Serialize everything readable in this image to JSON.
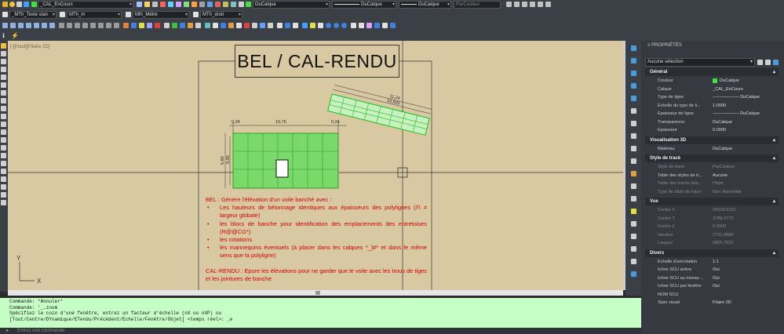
{
  "toolbar": {
    "layer_current": "_CAL_EnCours",
    "color": "DuCalque",
    "linetype": "DuCalque",
    "lineweight": "DuCalque",
    "plotstyle": "ParCouleur",
    "text_style": "_MTh_Texte stan",
    "dim_style": "MTh_m",
    "table_style": "Mth_Métré",
    "multileader_style": "MTh_droit"
  },
  "canvas": {
    "viewport_label": "[-][Haut][Filaire 2D]",
    "title": "BEL / CAL-RENDU",
    "dims": {
      "left_gap": "0,24",
      "top_length": "10,76",
      "right_gap": "0,24",
      "height_outer": "5,60",
      "height_inner": "5,00",
      "rot_length": "11,24",
      "rot_length2": "10,500"
    },
    "description": {
      "intro": "BEL : Génère l'élévation d'un voile banché avec :",
      "bullets": [
        "Les hauteurs de bétonnage identiques aux épaisseurs des polylignes (/!\\ ≠ largeur globale)",
        "les blocs de banche pour identification des emplacements des entretoises (R@@CG*)",
        "les cotations",
        "les mannequins éventuels (à placer dans les calques *_)#* et dans le même sens que la polyligne)"
      ],
      "outro": "CAL-RENDU : Epure les élévations pour ne garder que le voile avec les trous de tiges et les jointures de banche"
    },
    "ucs": {
      "x": "X",
      "y": "Y"
    }
  },
  "command": {
    "lines": [
      "Commande: *Annuler*",
      "Commande: '_.zoom",
      "Spécifiez le coin d'une fenêtre, entrez un facteur d'échelle (nX ou nXP) ou",
      "[Tout/Centre/DYnamique/ETendu/Précédent/Echelle/Fenêtre/Objet] <temps réel>: _e"
    ],
    "placeholder": "Entrez une commande"
  },
  "properties": {
    "title": "PROPRIÉTÉS",
    "selection": "Aucune sélection",
    "sections": [
      {
        "name": "Général",
        "rows": [
          {
            "k": "Couleur",
            "v": "DuCalque",
            "swatch": "#44dd44"
          },
          {
            "k": "Calque",
            "v": "_CAL_EnCours"
          },
          {
            "k": "Type de ligne",
            "v": "—————— DuCalque"
          },
          {
            "k": "Echelle du type de li...",
            "v": "1.0000"
          },
          {
            "k": "Epaisseur de ligne",
            "v": "—————— DuCalque"
          },
          {
            "k": "Transparence",
            "v": "DuCalque"
          },
          {
            "k": "Epaisseur",
            "v": "0.0000"
          }
        ]
      },
      {
        "name": "Visualisation 3D",
        "rows": [
          {
            "k": "Matériau",
            "v": "DuCalque"
          }
        ]
      },
      {
        "name": "Style de tracé",
        "rows": [
          {
            "k": "Style de tracé",
            "v": "ParCouleur",
            "dim": true
          },
          {
            "k": "Table des styles de tr...",
            "v": "Aucune"
          },
          {
            "k": "Table des tracés atta...",
            "v": "Objet",
            "dim": true
          },
          {
            "k": "Type de table de tracé",
            "v": "Non disponible",
            "dim": true
          }
        ]
      },
      {
        "name": "Vue",
        "rows": [
          {
            "k": "Centre X",
            "v": "26629.5391",
            "dim": true
          },
          {
            "k": "Centre Y",
            "v": "3788.4772",
            "dim": true
          },
          {
            "k": "Centre Z",
            "v": "0.0000",
            "dim": true
          },
          {
            "k": "Hauteur",
            "v": "2732.8889",
            "dim": true
          },
          {
            "k": "Largeur",
            "v": "6805.7532",
            "dim": true
          }
        ]
      },
      {
        "name": "Divers",
        "rows": [
          {
            "k": "Echelle d'annotation",
            "v": "1:1"
          },
          {
            "k": "Icône SCU active",
            "v": "Oui"
          },
          {
            "k": "Icône SCU au niveau ...",
            "v": "Oui"
          },
          {
            "k": "Icône SCU par fenêtre",
            "v": "Oui"
          },
          {
            "k": "NOM SCU",
            "v": ""
          },
          {
            "k": "Style visuel",
            "v": "Filaire 2D"
          }
        ]
      }
    ]
  }
}
